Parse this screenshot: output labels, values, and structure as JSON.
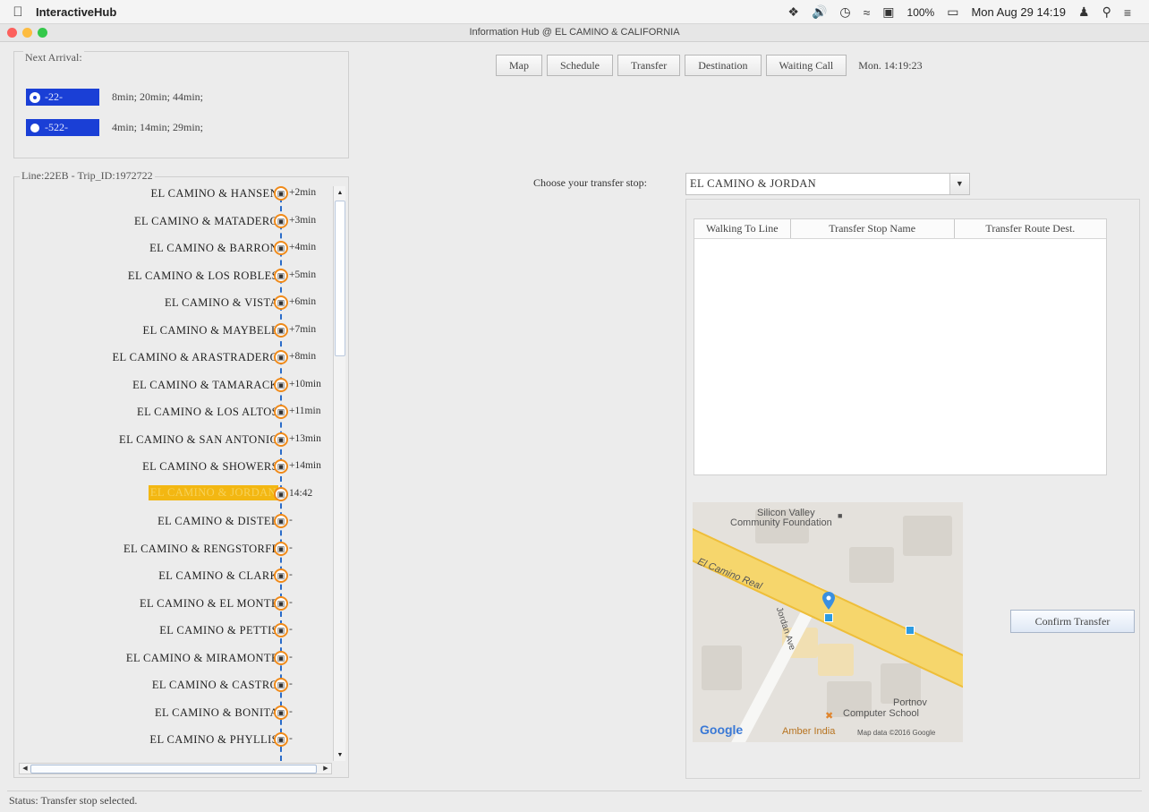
{
  "menubar": {
    "app_name": "InteractiveHub",
    "battery": "100%",
    "datetime": "Mon Aug 29  14:19"
  },
  "window": {
    "title": "Information Hub @ EL CAMINO & CALIFORNIA"
  },
  "arrival": {
    "title": "Next Arrival:",
    "lines": [
      {
        "label": "-22-",
        "times": "8min; 20min; 44min;",
        "selected": true
      },
      {
        "label": "-522-",
        "times": "4min; 14min; 29min;",
        "selected": false
      }
    ]
  },
  "trip": {
    "title": "Line:22EB - Trip_ID:1972722",
    "stops": [
      {
        "name": "EL CAMINO & HANSEN",
        "eta": "+2min"
      },
      {
        "name": "EL CAMINO & MATADERO",
        "eta": "+3min"
      },
      {
        "name": "EL CAMINO & BARRON",
        "eta": "+4min"
      },
      {
        "name": "EL CAMINO & LOS ROBLES",
        "eta": "+5min"
      },
      {
        "name": "EL CAMINO & VISTA",
        "eta": "+6min"
      },
      {
        "name": "EL CAMINO & MAYBELL",
        "eta": "+7min"
      },
      {
        "name": "EL CAMINO & ARASTRADERO",
        "eta": "+8min"
      },
      {
        "name": "EL CAMINO & TAMARACK",
        "eta": "+10min"
      },
      {
        "name": "EL CAMINO & LOS ALTOS",
        "eta": "+11min"
      },
      {
        "name": "EL CAMINO & SAN ANTONIO",
        "eta": "+13min"
      },
      {
        "name": "EL CAMINO & SHOWERS",
        "eta": "+14min"
      },
      {
        "name": "EL CAMINO & JORDAN",
        "eta": "14:42",
        "highlight": true
      },
      {
        "name": "EL CAMINO & DISTEL",
        "eta": "-"
      },
      {
        "name": "EL CAMINO & RENGSTORFF",
        "eta": "-"
      },
      {
        "name": "EL CAMINO & CLARK",
        "eta": "-"
      },
      {
        "name": "EL CAMINO & EL MONTE",
        "eta": "-"
      },
      {
        "name": "EL CAMINO & PETTIS",
        "eta": "-"
      },
      {
        "name": "EL CAMINO & MIRAMONTE",
        "eta": "-"
      },
      {
        "name": "EL CAMINO & CASTRO",
        "eta": "-"
      },
      {
        "name": "EL CAMINO & BONITA",
        "eta": "-"
      },
      {
        "name": "EL CAMINO & PHYLLIS",
        "eta": "-"
      }
    ]
  },
  "toolbar": {
    "tabs": [
      "Map",
      "Schedule",
      "Transfer",
      "Destination",
      "Waiting Call"
    ],
    "clock": "Mon. 14:19:23"
  },
  "transfer": {
    "label": "Choose your transfer stop:",
    "selected_stop": "EL CAMINO & JORDAN",
    "columns": [
      "Walking To Line",
      "Transfer Stop Name",
      "Transfer Route Dest."
    ],
    "confirm_label": "Confirm Transfer"
  },
  "map": {
    "labels": {
      "poi1": "Silicon Valley",
      "poi1b": "Community Foundation",
      "road": "El Camino Real",
      "side_road": "Jordan Ave",
      "poi2": "Portnov",
      "poi2b": "Computer School",
      "poi3": "Amber India",
      "brand": "Google",
      "credit": "Map data ©2016 Google"
    }
  },
  "status": {
    "text": "Status: Transfer stop selected."
  },
  "colors": {
    "line_chip": "#1a3fd6",
    "highlight": "#f3b712",
    "bus_ring": "#ef8a1a",
    "route_line": "#2a6cc9"
  }
}
